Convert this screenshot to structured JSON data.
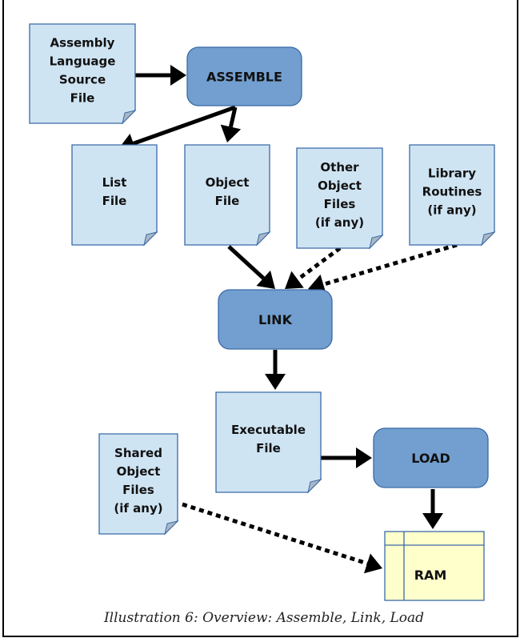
{
  "colors": {
    "doc_fill": "#cfe4f3",
    "doc_stroke": "#3a6aa6",
    "fold_fill": "#a9b7c4",
    "process_fill": "#729fcf",
    "process_stroke": "#3a6aa6",
    "ram_fill": "#ffffcc",
    "arrow": "#000000"
  },
  "documents": [
    {
      "id": "asm_src",
      "lines": [
        "Assembly",
        "Language",
        "Source",
        "File"
      ]
    },
    {
      "id": "list_file",
      "lines": [
        "List",
        "File"
      ]
    },
    {
      "id": "object_file",
      "lines": [
        "Object",
        "File"
      ]
    },
    {
      "id": "other_objects",
      "lines": [
        "Other",
        "Object",
        "Files",
        "(if any)"
      ]
    },
    {
      "id": "library",
      "lines": [
        "Library",
        "Routines",
        "(if any)"
      ]
    },
    {
      "id": "executable",
      "lines": [
        "Executable",
        "File"
      ]
    },
    {
      "id": "shared_objects",
      "lines": [
        "Shared",
        "Object",
        "Files",
        "(if any)"
      ]
    }
  ],
  "processes": [
    {
      "id": "assemble",
      "label": "ASSEMBLE"
    },
    {
      "id": "link",
      "label": "LINK"
    },
    {
      "id": "load",
      "label": "LOAD"
    }
  ],
  "storage": {
    "id": "ram",
    "label": "RAM"
  },
  "edges": [
    {
      "from": "asm_src",
      "to": "assemble",
      "style": "solid"
    },
    {
      "from": "assemble",
      "to": "list_file",
      "style": "solid"
    },
    {
      "from": "assemble",
      "to": "object_file",
      "style": "solid"
    },
    {
      "from": "object_file",
      "to": "link",
      "style": "solid"
    },
    {
      "from": "other_objects",
      "to": "link",
      "style": "dotted"
    },
    {
      "from": "library",
      "to": "link",
      "style": "dotted"
    },
    {
      "from": "link",
      "to": "executable",
      "style": "solid"
    },
    {
      "from": "executable",
      "to": "load",
      "style": "solid"
    },
    {
      "from": "load",
      "to": "ram",
      "style": "solid"
    },
    {
      "from": "shared_objects",
      "to": "ram",
      "style": "dotted"
    }
  ],
  "caption": "Illustration 6: Overview: Assemble, Link, Load"
}
